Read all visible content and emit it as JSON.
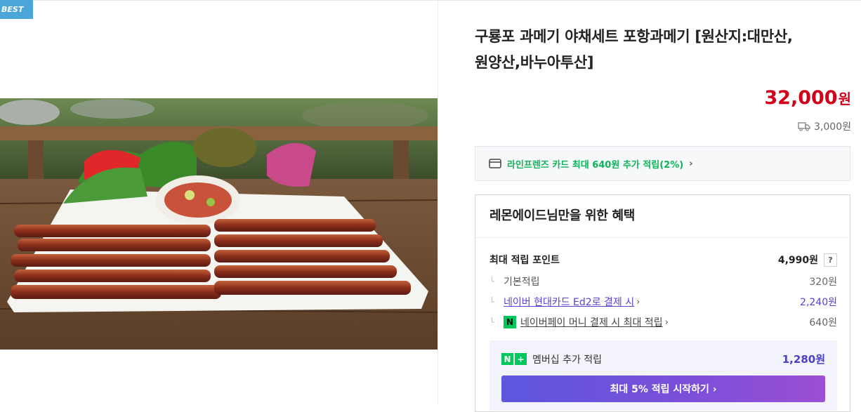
{
  "badge": "BEST",
  "product": {
    "title_line1": "구룡포 과메기 야채세트 포항과메기 [원산지:대만산,",
    "title_line2": "원양산,바누아투산]",
    "price": "32,000",
    "price_unit": "원",
    "shipping": "3,000원"
  },
  "card_promo": {
    "text": "라인프렌즈 카드 최대 640원 추가 적립(2%)",
    "chevron": "›"
  },
  "benefit": {
    "title": "레몬에이드님만을 위한 혜택",
    "max_points_label": "최대 적립 포인트",
    "max_points_value": "4,990원",
    "help": "?",
    "rows": [
      {
        "label": "기본적립",
        "value": "320원"
      },
      {
        "label": "네이버 현대카드 Ed2로 결제 시",
        "value": "2,240원"
      },
      {
        "label": "네이버페이 머니 결제 시 최대 적립",
        "value": "640원"
      }
    ],
    "npay_badge": "N",
    "membership_logo": {
      "n": "N",
      "plus": "+"
    },
    "membership_label": "멤버십 추가 적립",
    "membership_value": "1,280원",
    "start_button": "최대 5% 적립 시작하기 ›"
  },
  "colors": {
    "price": "#d0021b",
    "green": "#0fb35a",
    "purple_link": "#5b3fd6",
    "badge": "#4aa6d9"
  }
}
